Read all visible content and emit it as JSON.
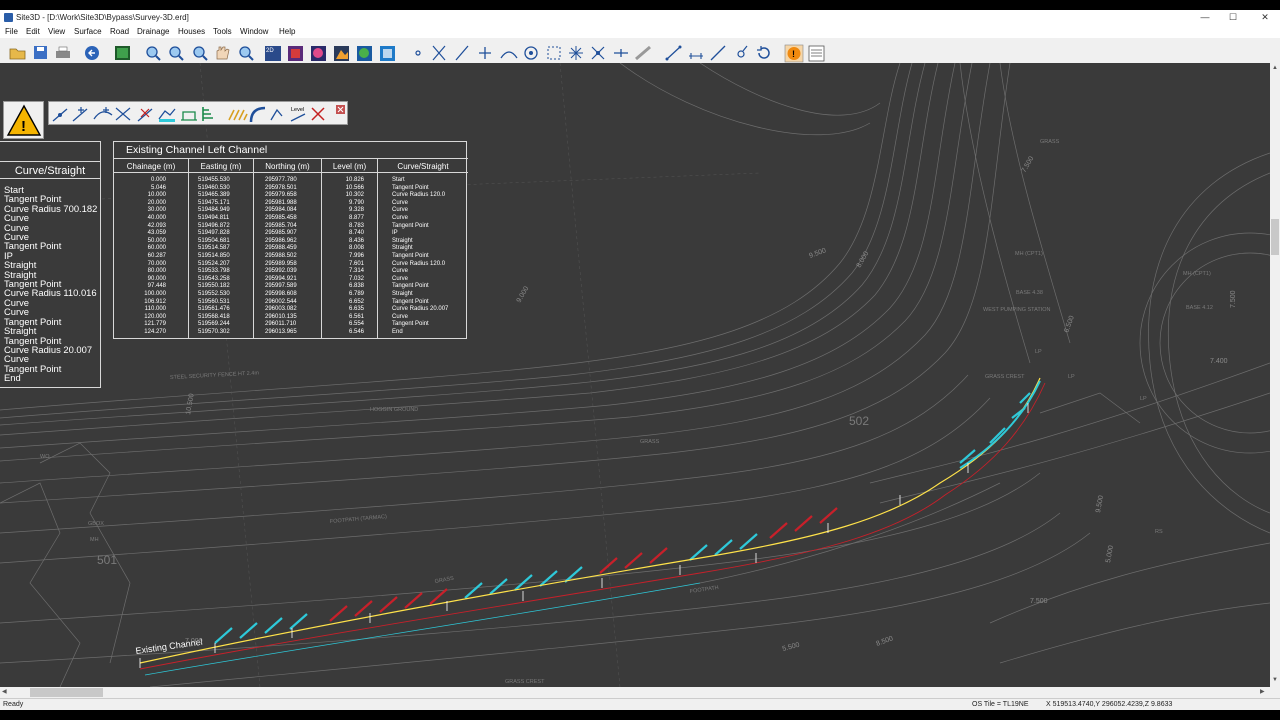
{
  "window": {
    "title": "Site3D - [D:\\Work\\Site3D\\Bypass\\Survey-3D.erd]",
    "minimize": "—",
    "maximize": "☐",
    "close": "✕"
  },
  "menu": [
    "File",
    "Edit",
    "View",
    "Surface",
    "Road",
    "Drainage",
    "Houses",
    "Tools",
    "Window",
    "Help"
  ],
  "left_panel": {
    "title": "Curve/Straight",
    "items": [
      "Start",
      "Tangent Point",
      "Curve Radius 700.182",
      "Curve",
      "Curve",
      "Curve",
      "Tangent Point",
      "IP",
      "Straight",
      "Straight",
      "Tangent Point",
      "Curve Radius 110.016",
      "Curve",
      "Curve",
      "Tangent Point",
      "Straight",
      "Tangent Point",
      "Curve Radius 20.007",
      "Curve",
      "Tangent Point",
      "End"
    ]
  },
  "table": {
    "title": "Existing Channel Left Channel",
    "headers": [
      "Chainage (m)",
      "Easting (m)",
      "Northing (m)",
      "Level (m)",
      "Curve/Straight"
    ],
    "chainage": [
      "0.000",
      "5.046",
      "10.000",
      "20.000",
      "30.000",
      "40.000",
      "42.093",
      "43.059",
      "50.000",
      "60.000",
      "60.287",
      "70.000",
      "80.000",
      "90.000",
      "97.448",
      "100.000",
      "106.912",
      "110.000",
      "120.000",
      "121.779",
      "124.270"
    ],
    "easting": [
      "519455.530",
      "519460.530",
      "519465.389",
      "519475.171",
      "519484.949",
      "519494.811",
      "519496.872",
      "519497.828",
      "519504.681",
      "519514.587",
      "519514.850",
      "519524.207",
      "519533.798",
      "519543.258",
      "519550.182",
      "519552.530",
      "519560.531",
      "519561.476",
      "519568.418",
      "519569.244",
      "519570.302"
    ],
    "northing": [
      "295977.780",
      "295978.501",
      "295979.658",
      "295981.988",
      "295984.084",
      "295985.458",
      "295985.704",
      "295985.907",
      "295986.962",
      "295988.459",
      "295988.502",
      "295989.958",
      "295992.039",
      "295994.921",
      "295997.589",
      "295998.608",
      "296002.544",
      "296003.082",
      "296010.135",
      "296011.710",
      "296013.965"
    ],
    "level": [
      "10.826",
      "10.566",
      "10.302",
      "9.790",
      "9.328",
      "8.877",
      "8.783",
      "8.740",
      "8.436",
      "8.008",
      "7.996",
      "7.601",
      "7.314",
      "7.032",
      "6.838",
      "6.789",
      "6.652",
      "6.635",
      "6.561",
      "6.554",
      "6.546"
    ],
    "curve": [
      "Start",
      "Tangent Point",
      "Curve Radius 120.0",
      "Curve",
      "Curve",
      "Curve",
      "Tangent Point",
      "IP",
      "Straight",
      "Straight",
      "Tangent Point",
      "Curve Radius 120.0",
      "Curve",
      "Curve",
      "Tangent Point",
      "Straight",
      "Tangent Point",
      "Curve Radius 20.007",
      "Curve",
      "Tangent Point",
      "End"
    ]
  },
  "map": {
    "channel_label": "Existing Channel",
    "plot_501": "501",
    "plot_502": "502",
    "contour_labels": [
      "9.000",
      "7.500",
      "9.500",
      "8.000",
      "10.500",
      "6.500",
      "7.500",
      "9.500",
      "7.400",
      "5.000",
      "5.500",
      "7.500",
      "8.500",
      "7.000"
    ],
    "annotations": [
      "STEEL SECURITY FENCE HT 2.4m",
      "HOGGIN GROUND",
      "FOOTPATH (TARMAC)",
      "GRASS",
      "GRASS",
      "GRASS CREST",
      "GRASS CREST",
      "FOOTPATH",
      "MH (CPT1)",
      "MH (CPT1)",
      "WEST PUMPING STATION",
      "BASE 4.38",
      "BASE 4.12",
      "GRASS",
      "MH",
      "GBOX",
      "WO",
      "LP",
      "LP",
      "LP",
      "RS"
    ]
  },
  "status": {
    "left": "Ready",
    "os_tile": "OS Tile = TL19NE",
    "coords": "X 519513.4740,Y 296052.4239,Z 9.8633"
  },
  "colors": {
    "viewport_bg": "#3a3a3a",
    "linework": "#6d6d6d",
    "chainage_line": "#ffe24a",
    "cyan_hatch": "#2ec9d9",
    "red_hatch": "#c8202a"
  }
}
